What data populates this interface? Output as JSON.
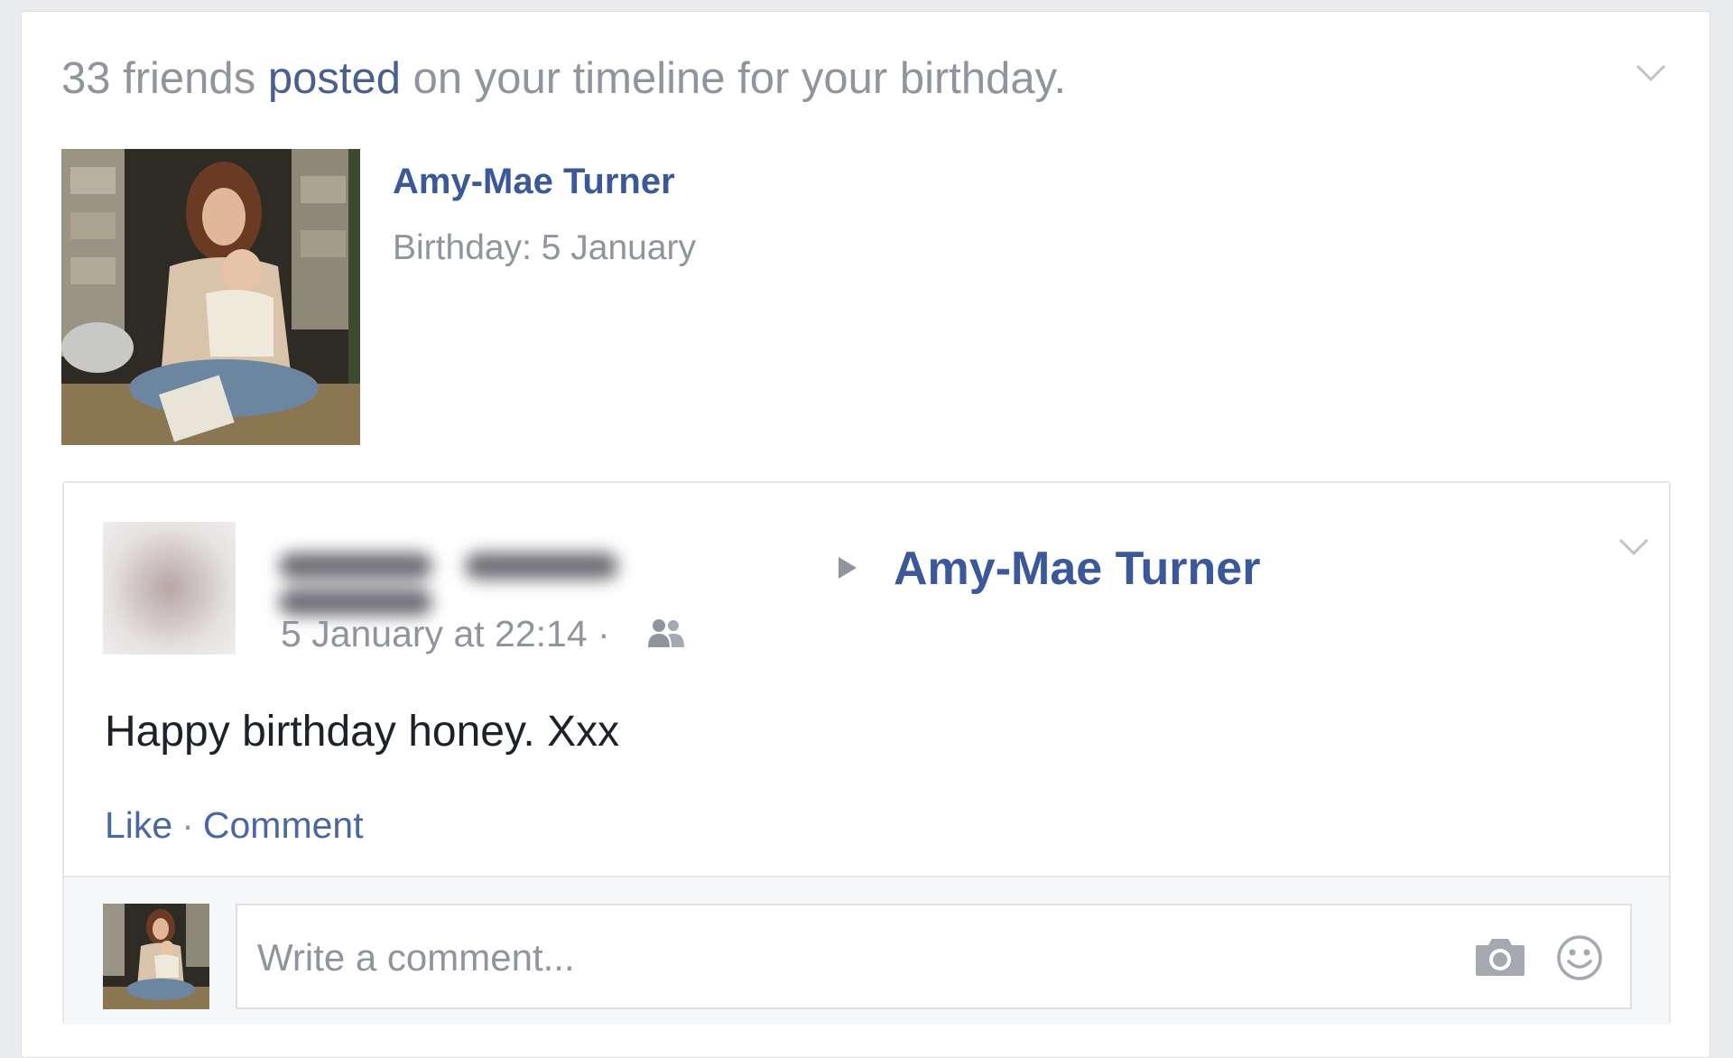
{
  "notification": {
    "count_text": "33 friends",
    "link_text": "posted",
    "rest_text": "on your timeline for your birthday."
  },
  "profile": {
    "name": "Amy-Mae Turner",
    "birthday_text": "Birthday: 5 January"
  },
  "post": {
    "target_name": "Amy-Mae Turner",
    "timestamp": "5 January at 22:14",
    "separator": "·",
    "audience_icon": "friends-icon",
    "body": "Happy birthday honey. Xxx",
    "actions": {
      "like": "Like",
      "separator": "·",
      "comment": "Comment"
    }
  },
  "comment_composer": {
    "placeholder": "Write a comment...",
    "icons": [
      "camera-icon",
      "emoji-icon"
    ]
  },
  "colors": {
    "background": "#e9ebee",
    "link_blue": "#3b5998",
    "action_blue": "#4b67a1",
    "muted_gray": "#90949c",
    "body_text": "#1d2129"
  }
}
